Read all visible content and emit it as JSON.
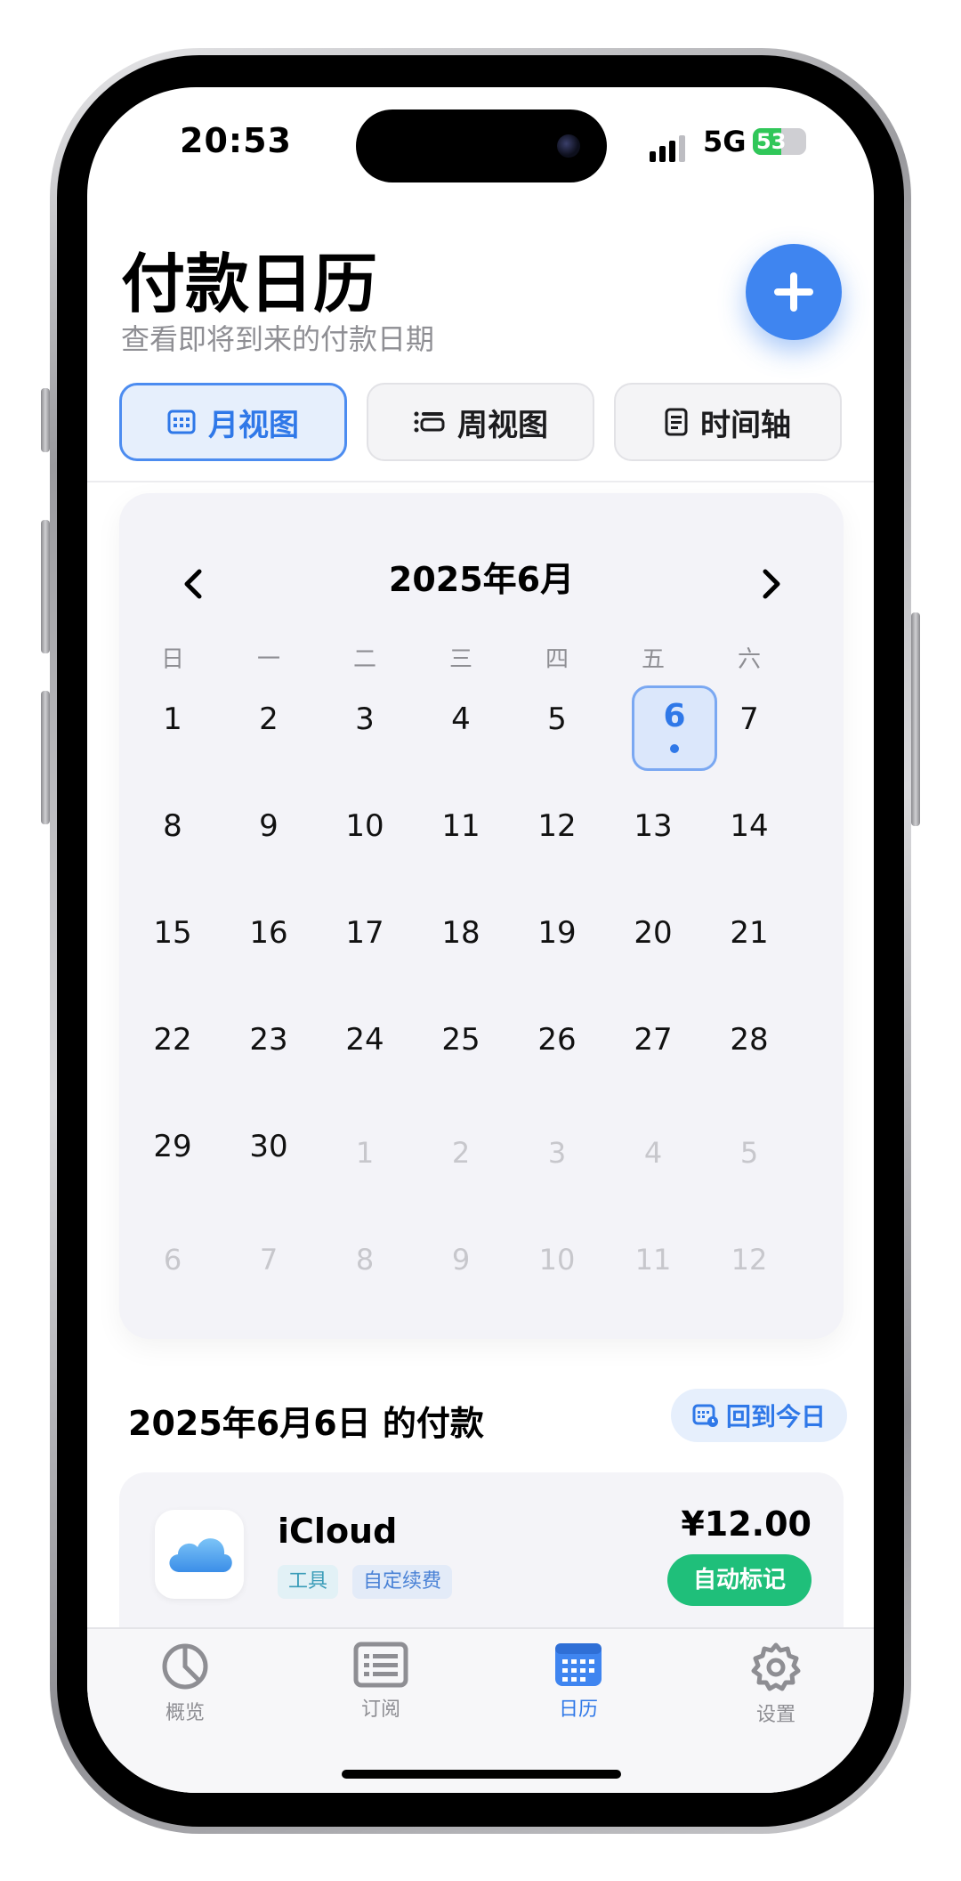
{
  "status": {
    "time": "20:53",
    "network": "5G",
    "battery": "53"
  },
  "header": {
    "title": "付款日历",
    "subtitle": "查看即将到来的付款日期",
    "add_icon": "plus-icon"
  },
  "views": [
    {
      "label": "月视图",
      "icon": "calendar-grid-icon",
      "active": true
    },
    {
      "label": "周视图",
      "icon": "week-list-icon",
      "active": false
    },
    {
      "label": "时间轴",
      "icon": "timeline-doc-icon",
      "active": false
    }
  ],
  "calendar": {
    "title": "2025年6月",
    "weekdays": [
      "日",
      "一",
      "二",
      "三",
      "四",
      "五",
      "六"
    ],
    "weeks": [
      [
        "1",
        "2",
        "3",
        "4",
        "5",
        "6",
        "7"
      ],
      [
        "8",
        "9",
        "10",
        "11",
        "12",
        "13",
        "14"
      ],
      [
        "15",
        "16",
        "17",
        "18",
        "19",
        "20",
        "21"
      ],
      [
        "22",
        "23",
        "24",
        "25",
        "26",
        "27",
        "28"
      ],
      [
        "29",
        "30",
        "1",
        "2",
        "3",
        "4",
        "5"
      ],
      [
        "6",
        "7",
        "8",
        "9",
        "10",
        "11",
        "12"
      ]
    ],
    "selected": "6"
  },
  "payments": {
    "title": "2025年6月6日 的付款",
    "today_label": "回到今日",
    "item": {
      "name": "iCloud",
      "tags": [
        "工具",
        "自定续费"
      ],
      "price": "¥12.00",
      "action": "自动标记"
    }
  },
  "tabbar": [
    {
      "label": "概览",
      "icon": "pie-chart-icon"
    },
    {
      "label": "订阅",
      "icon": "list-icon"
    },
    {
      "label": "日历",
      "icon": "calendar-icon",
      "active": true
    },
    {
      "label": "设置",
      "icon": "gear-icon"
    }
  ],
  "colors": {
    "accent": "#3f85f0",
    "success": "#1fbf7a"
  }
}
